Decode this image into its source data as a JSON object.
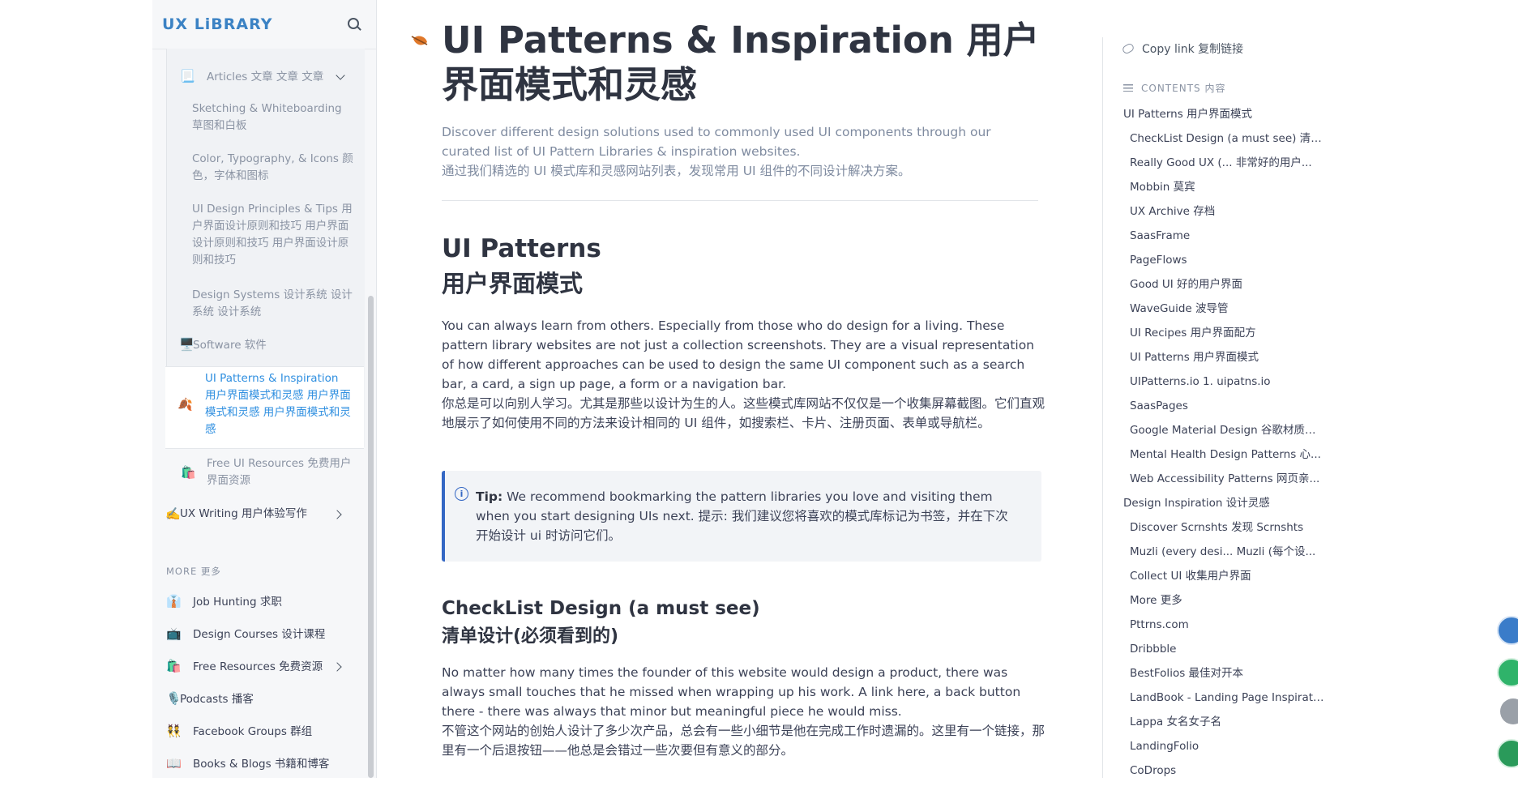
{
  "sidebar": {
    "logo": "UX LiBRARY",
    "nested": {
      "articles": "Articles 文章 文章 文章",
      "sub": [
        "Sketching & Whiteboarding 草图和白板",
        "Color, Typography, & Icons 颜色，字体和图标",
        "UI Design Principles & Tips 用户界面设计原则和技巧 用户界面设计原则和技巧 用户界面设计原则和技巧",
        "Design Systems 设计系统 设计系统 设计系统"
      ],
      "software": "Software 软件",
      "active": "UI Patterns & Inspiration 用户界面模式和灵感 用户界面模式和灵感 用户界面模式和灵感",
      "free_ui": "Free UI Resources 免费用户界面资源"
    },
    "ux_writing": "UX Writing 用户体验写作",
    "more_title": "MORE 更多",
    "more": [
      {
        "icon": "👔",
        "label": "Job Hunting 求职"
      },
      {
        "icon": "📺",
        "label": "Design Courses 设计课程"
      },
      {
        "icon": "🛍️",
        "label": "Free Resources 免费资源"
      },
      {
        "icon": "🎙️",
        "label": "Podcasts 播客"
      },
      {
        "icon": "👯",
        "label": "Facebook Groups 群组"
      },
      {
        "icon": "📖",
        "label": "Books & Blogs 书籍和博客"
      }
    ],
    "icons": {
      "articles": "📃",
      "software": "🖥️",
      "free_ui": "🛍️",
      "ux_writing": "✍️",
      "active": "🍂"
    }
  },
  "main": {
    "title": "UI Patterns & Inspiration 用户界面模式和灵感",
    "intro_en": "Discover different design solutions used to commonly used UI components through our curated list of UI Pattern Libraries & inspiration websites.",
    "intro_zh": "通过我们精选的 UI 模式库和灵感网站列表，发现常用 UI 组件的不同设计解决方案。",
    "section1_en": "UI Patterns",
    "section1_zh": "用户界面模式",
    "p1_en": "You can always learn from others. Especially from those who do design for a living. These pattern library websites are not just a collection screenshots. They are a visual representation of how different approaches can be used to design the same UI component such as a search bar, a card, a sign up page, a form or a navigation bar.",
    "p1_zh": "你总是可以向别人学习。尤其是那些以设计为生的人。这些模式库网站不仅仅是一个收集屏幕截图。它们直观地展示了如何使用不同的方法来设计相同的 UI 组件，如搜索栏、卡片、注册页面、表单或导航栏。",
    "tip_label": "Tip:",
    "tip_text": " We recommend bookmarking the pattern libraries you love and visiting them when you start designing UIs next. 提示: 我们建议您将喜欢的模式库标记为书签，并在下次开始设计 ui 时访问它们。",
    "section2_en": "CheckList Design (a must see)",
    "section2_zh": "清单设计(必须看到的)",
    "p2_en": "No matter how many times the founder of this website would design a product, there was always small touches that he missed when wrapping up his work. A link here, a back button there - there was always that minor but meaningful piece he would miss.",
    "p2_zh": "不管这个网站的创始人设计了多少次产品，总会有一些小细节是他在完成工作时遗漏的。这里有一个链接，那里有一个后退按钮——他总是会错过一些次要但有意义的部分。"
  },
  "toc": {
    "copy_link": "Copy link 复制链接",
    "heading": "CONTENTS 内容",
    "items": [
      {
        "label": "UI Patterns 用户界面模式",
        "level": 1
      },
      {
        "label": "CheckList Design (a must see) 清单...",
        "level": 2
      },
      {
        "label": "Really Good UX (...    非常好的用户...",
        "level": 2
      },
      {
        "label": "Mobbin 莫宾",
        "level": 2
      },
      {
        "label": "UX Archive 存档",
        "level": 2
      },
      {
        "label": "SaasFrame",
        "level": 2
      },
      {
        "label": "PageFlows",
        "level": 2
      },
      {
        "label": "Good UI 好的用户界面",
        "level": 2
      },
      {
        "label": "WaveGuide 波导管",
        "level": 2
      },
      {
        "label": "UI Recipes 用户界面配方",
        "level": 2
      },
      {
        "label": "UI Patterns 用户界面模式",
        "level": 2
      },
      {
        "label": "UIPatterns.io 1. uipatns.io",
        "level": 2
      },
      {
        "label": "SaasPages",
        "level": 2
      },
      {
        "label": "Google Material Design 谷歌材质设计",
        "level": 2
      },
      {
        "label": "Mental Health Design Patterns 心...",
        "level": 2
      },
      {
        "label": "Web Accessibility Patterns 网页亲...",
        "level": 2
      },
      {
        "label": "Design Inspiration 设计灵感",
        "level": 1
      },
      {
        "label": "Discover Scrnshts 发现 Scrnshts",
        "level": 2
      },
      {
        "label": "Muzli (every desi...    Muzli (每个设...",
        "level": 2
      },
      {
        "label": "Collect UI 收集用户界面",
        "level": 2
      },
      {
        "label": "More  更多",
        "level": 2
      },
      {
        "label": "Pttrns.com",
        "level": 2
      },
      {
        "label": "Dribbble",
        "level": 2
      },
      {
        "label": "BestFolios 最佳对开本",
        "level": 2
      },
      {
        "label": "LandBook - Landing Page Inspirati...",
        "level": 2
      },
      {
        "label": "Lappa  女名女子名",
        "level": 2
      },
      {
        "label": "LandingFolio",
        "level": 2
      },
      {
        "label": "CoDrops",
        "level": 2
      }
    ]
  },
  "colors": {
    "accent": "#3b82c4",
    "active_text": "#2f8fe0",
    "tip_border": "#3467c4"
  }
}
